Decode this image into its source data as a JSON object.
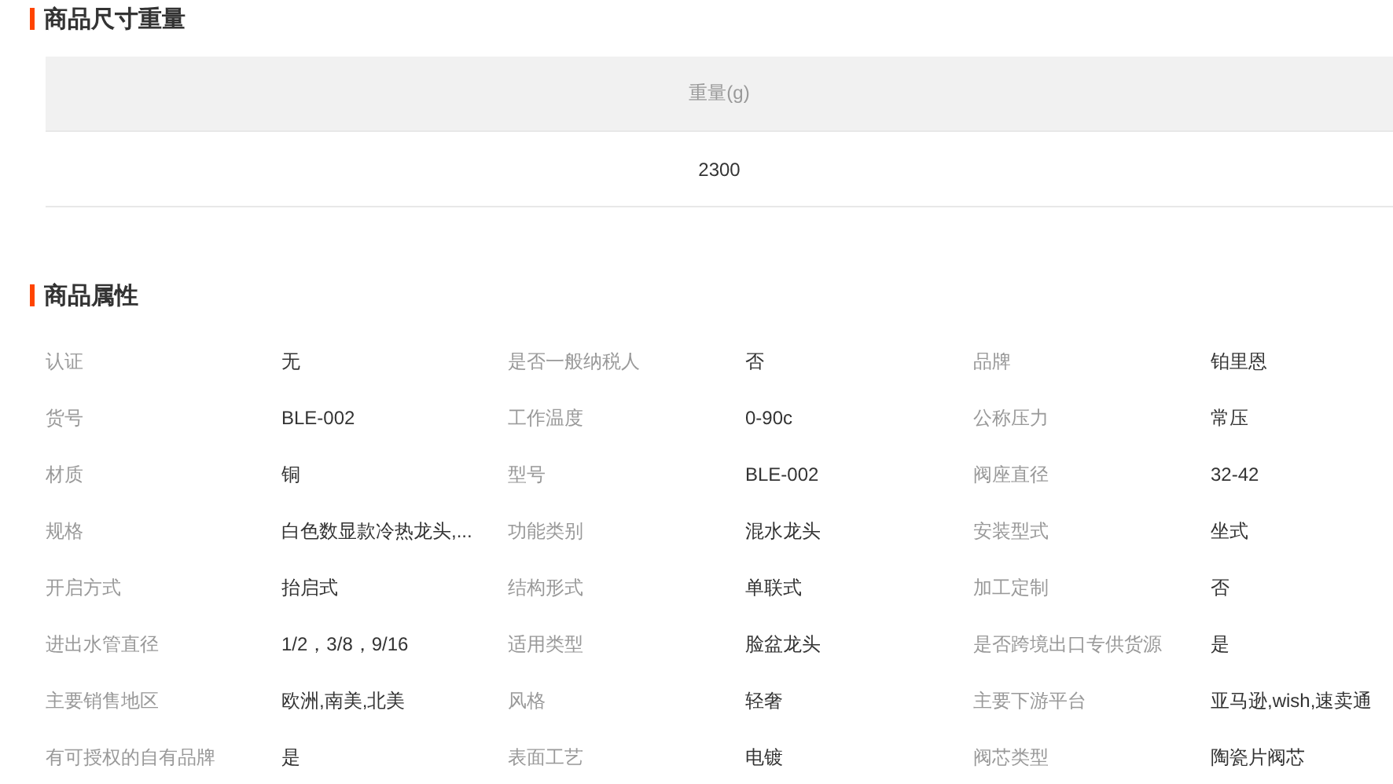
{
  "size_section": {
    "title": "商品尺寸重量",
    "columns": [
      "重量(g)"
    ],
    "rows": [
      [
        "2300"
      ]
    ]
  },
  "attributes_section": {
    "title": "商品属性",
    "items": [
      {
        "label": "认证",
        "value": "无"
      },
      {
        "label": "是否一般纳税人",
        "value": "否"
      },
      {
        "label": "品牌",
        "value": "铂里恩"
      },
      {
        "label": "货号",
        "value": "BLE-002"
      },
      {
        "label": "工作温度",
        "value": "0-90c"
      },
      {
        "label": "公称压力",
        "value": "常压"
      },
      {
        "label": "材质",
        "value": "铜"
      },
      {
        "label": "型号",
        "value": "BLE-002"
      },
      {
        "label": "阀座直径",
        "value": "32-42"
      },
      {
        "label": "规格",
        "value": "白色数显款冷热龙头,..."
      },
      {
        "label": "功能类别",
        "value": "混水龙头"
      },
      {
        "label": "安装型式",
        "value": "坐式"
      },
      {
        "label": "开启方式",
        "value": "抬启式"
      },
      {
        "label": "结构形式",
        "value": "单联式"
      },
      {
        "label": "加工定制",
        "value": "否"
      },
      {
        "label": "进出水管直径",
        "value": "1/2，3/8，9/16"
      },
      {
        "label": "适用类型",
        "value": "脸盆龙头"
      },
      {
        "label": "是否跨境出口专供货源",
        "value": "是"
      },
      {
        "label": "主要销售地区",
        "value": "欧洲,南美,北美"
      },
      {
        "label": "风格",
        "value": "轻奢"
      },
      {
        "label": "主要下游平台",
        "value": "亚马逊,wish,速卖通"
      },
      {
        "label": "有可授权的自有品牌",
        "value": "是"
      },
      {
        "label": "表面工艺",
        "value": "电镀"
      },
      {
        "label": "阀芯类型",
        "value": "陶瓷片阀芯"
      }
    ]
  }
}
